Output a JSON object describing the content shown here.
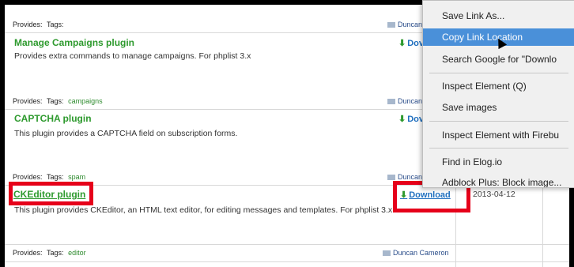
{
  "rows": [
    {
      "provides": "Provides:",
      "tags_label": "Tags:",
      "tag": "",
      "author": "Duncan"
    },
    {
      "title": "Manage Campaigns plugin",
      "description": "Provides extra commands to manage campaigns. For phplist 3.x",
      "download": "Dov"
    },
    {
      "provides": "Provides:",
      "tags_label": "Tags:",
      "tag": "campaigns",
      "author": "Duncan"
    },
    {
      "title": "CAPTCHA plugin",
      "description": "This plugin provides a CAPTCHA field on subscription forms.",
      "download": "Dov"
    },
    {
      "provides": "Provides:",
      "tags_label": "Tags:",
      "tag": "spam",
      "author": "Duncan"
    },
    {
      "title": "CKEditor plugin",
      "description": "This plugin provides CKEditor, an HTML text editor, for editing messages and templates. For phplist 3.x.",
      "download": "Download",
      "date": "2013-04-12"
    },
    {
      "provides": "Provides:",
      "tags_label": "Tags:",
      "tag": "editor",
      "author": "Duncan Cameron"
    }
  ],
  "context_menu": {
    "items": [
      "Save Link As...",
      "Copy Link Location",
      "Search Google for \"Downlo",
      "Inspect Element (Q)",
      "Save images",
      "Inspect Element with Firebu",
      "Find in Elog.io",
      "Adblock Plus: Block image..."
    ]
  },
  "colors": {
    "highlight": "#4a90d9",
    "annotation_red": "#e6001a",
    "plugin_title": "#2e9a2e"
  }
}
